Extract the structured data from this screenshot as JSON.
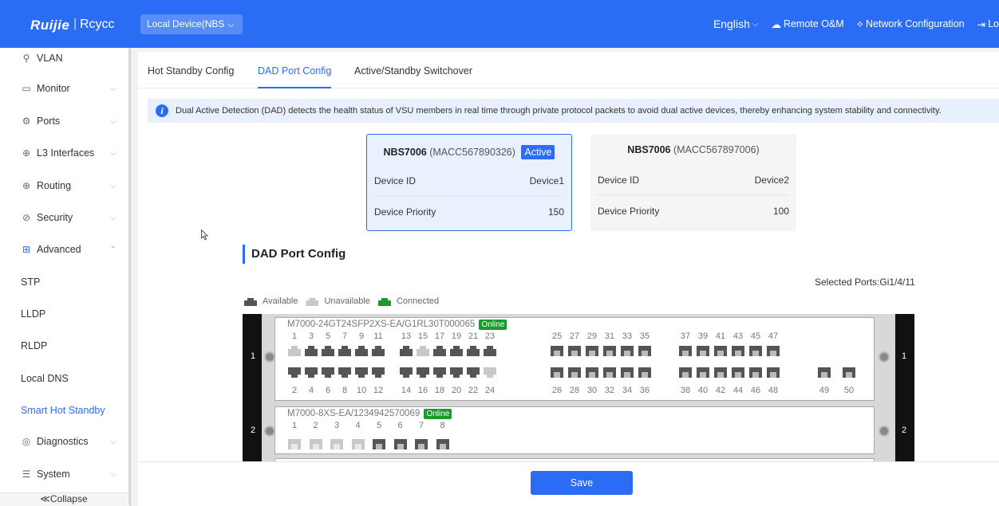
{
  "header": {
    "logo": "Ruijie",
    "logo_sub": "Rcycc",
    "device_select": "Local Device(NBS",
    "language": "English",
    "remote": "Remote O&M",
    "network_config": "Network Configuration",
    "logout": "Lo"
  },
  "sidebar": {
    "items": [
      {
        "label": "VLAN",
        "icon": "vlan-icon"
      },
      {
        "label": "Monitor",
        "icon": "monitor-icon"
      },
      {
        "label": "Ports",
        "icon": "ports-icon"
      },
      {
        "label": "L3 Interfaces",
        "icon": "globe-icon"
      },
      {
        "label": "Routing",
        "icon": "globe-icon"
      },
      {
        "label": "Security",
        "icon": "shield-icon"
      },
      {
        "label": "Advanced",
        "icon": "advanced-icon"
      }
    ],
    "sub_items": [
      "STP",
      "LLDP",
      "RLDP",
      "Local DNS",
      "Smart Hot Standby"
    ],
    "items_bottom": [
      {
        "label": "Diagnostics",
        "icon": "diagnostics-icon"
      },
      {
        "label": "System",
        "icon": "system-icon"
      }
    ],
    "collapse": "≪Collapse"
  },
  "tabs": [
    "Hot Standby Config",
    "DAD Port Config",
    "Active/Standby Switchover"
  ],
  "info_text": "Dual Active Detection (DAD) detects the health status of VSU members in real time through private protocol packets to avoid dual active devices, thereby enhancing system stability and connectivity.",
  "devices": [
    {
      "model": "NBS7006",
      "mac": "(MACC567890326)",
      "badge": "Active",
      "id_label": "Device ID",
      "id_value": "Device1",
      "prio_label": "Device Priority",
      "prio_value": "150"
    },
    {
      "model": "NBS7006",
      "mac": "(MACC567897006)",
      "badge": "",
      "id_label": "Device ID",
      "id_value": "Device2",
      "prio_label": "Device Priority",
      "prio_value": "100"
    }
  ],
  "section_title": "DAD Port Config",
  "selected_ports": "Selected Ports:Gi1/4/11",
  "legend": {
    "available": "Available",
    "unavailable": "Unavailable",
    "connected": "Connected"
  },
  "slots": [
    {
      "num": "1",
      "name": "M7000-24GT24SFP2XS-EA/G1RL30T000065",
      "status": "Online"
    },
    {
      "num": "2",
      "name": "M7000-8XS-EA/1234942570069",
      "status": "Online"
    }
  ],
  "colors": {
    "accent": "#2b6cf5",
    "online": "#1a9c2d",
    "port_dark": "#555555",
    "port_light": "#c8c8c8"
  },
  "save": "Save"
}
